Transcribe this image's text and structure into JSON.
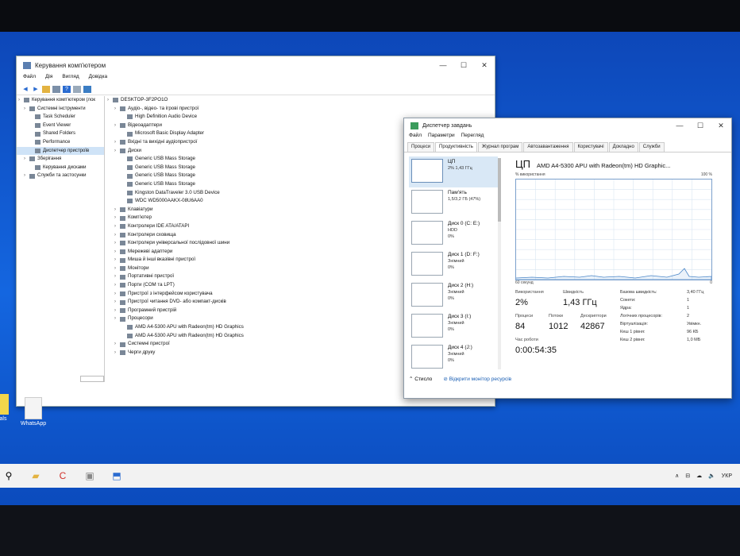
{
  "computer_management": {
    "title": "Керування комп'ютером",
    "menu": [
      "Файл",
      "Дія",
      "Вигляд",
      "Довідка"
    ],
    "left_tree": [
      {
        "label": "Керування комп'ютером (лок",
        "level": 0
      },
      {
        "label": "Системні інструменти",
        "level": 1
      },
      {
        "label": "Task Scheduler",
        "level": 2
      },
      {
        "label": "Event Viewer",
        "level": 2
      },
      {
        "label": "Shared Folders",
        "level": 2
      },
      {
        "label": "Performance",
        "level": 2
      },
      {
        "label": "Диспетчер пристроїв",
        "level": 2
      },
      {
        "label": "Зберігання",
        "level": 1
      },
      {
        "label": "Керування дисками",
        "level": 2
      },
      {
        "label": "Служби та застосунки",
        "level": 1
      }
    ],
    "device_tree": [
      {
        "label": "DESKTOP-3F2PO1O",
        "level": 0
      },
      {
        "label": "Аудіо-, відео- та ігрові пристрої",
        "level": 1
      },
      {
        "label": "High Definition Audio Device",
        "level": 2
      },
      {
        "label": "Відеоадаптери",
        "level": 1
      },
      {
        "label": "Microsoft Basic Display Adapter",
        "level": 2
      },
      {
        "label": "Вхідні та вихідні аудіопристрої",
        "level": 1
      },
      {
        "label": "Диски",
        "level": 1
      },
      {
        "label": "Generic USB Mass Storage",
        "level": 2
      },
      {
        "label": "Generic USB Mass Storage",
        "level": 2
      },
      {
        "label": "Generic USB Mass Storage",
        "level": 2
      },
      {
        "label": "Generic USB Mass Storage",
        "level": 2
      },
      {
        "label": "Kingston DataTraveler 3.0 USB Device",
        "level": 2
      },
      {
        "label": "WDC WD5000AAKX-08U6AA0",
        "level": 2
      },
      {
        "label": "Клавіатури",
        "level": 1
      },
      {
        "label": "Комп'ютер",
        "level": 1
      },
      {
        "label": "Контролери IDE ATA/ATAPI",
        "level": 1
      },
      {
        "label": "Контролери сховища",
        "level": 1
      },
      {
        "label": "Контролери універсальної послідовної шини",
        "level": 1
      },
      {
        "label": "Мережеві адаптери",
        "level": 1
      },
      {
        "label": "Миша й інші вказівні пристрої",
        "level": 1
      },
      {
        "label": "Монітори",
        "level": 1
      },
      {
        "label": "Портативні пристрої",
        "level": 1
      },
      {
        "label": "Порти (COM та LPT)",
        "level": 1
      },
      {
        "label": "Пристрої з інтерфейсом користувача",
        "level": 1
      },
      {
        "label": "Пристрої читання DVD- або компакт-дисків",
        "level": 1
      },
      {
        "label": "Програмний пристрій",
        "level": 1
      },
      {
        "label": "Процесори",
        "level": 1
      },
      {
        "label": "AMD A4-5300 APU with Radeon(tm) HD Graphics",
        "level": 2
      },
      {
        "label": "AMD A4-5300 APU with Radeon(tm) HD Graphics",
        "level": 2
      },
      {
        "label": "Системні пристрої",
        "level": 1
      },
      {
        "label": "Черги друку",
        "level": 1
      }
    ]
  },
  "task_manager": {
    "title": "Диспетчер завдань",
    "menu": [
      "Файл",
      "Параметри",
      "Перегляд"
    ],
    "tabs": [
      "Процеси",
      "Продуктивність",
      "Журнал програм",
      "Автозавантаження",
      "Користувачі",
      "Докладно",
      "Служби"
    ],
    "resources": [
      {
        "name": "ЦП",
        "line1": "2% 1,43 ГГц",
        "line2": ""
      },
      {
        "name": "Пам'ять",
        "line1": "1,5/3,2 ГБ (47%)",
        "line2": ""
      },
      {
        "name": "Диск 0 (C: E:)",
        "line1": "HDD",
        "line2": "0%"
      },
      {
        "name": "Диск 1 (D: F:)",
        "line1": "Знімний",
        "line2": "0%"
      },
      {
        "name": "Диск 2 (H:)",
        "line1": "Знімний",
        "line2": "0%"
      },
      {
        "name": "Диск 3 (I:)",
        "line1": "Знімний",
        "line2": "0%"
      },
      {
        "name": "Диск 4 (J:)",
        "line1": "Знімний",
        "line2": "0%"
      }
    ],
    "cpu": {
      "heading": "ЦП",
      "model": "AMD A4-5300 APU with Radeon(tm) HD Graphic...",
      "graph_label": "% використання",
      "graph_max": "100 %",
      "graph_time": "60 секунд",
      "graph_min": "0",
      "utilization_label": "Використання",
      "utilization": "2%",
      "speed_label": "Швидкість",
      "speed": "1,43 ГГц",
      "processes_label": "Процеси",
      "processes": "84",
      "threads_label": "Потоки",
      "threads": "1012",
      "handles_label": "Дескриптори",
      "handles": "42867",
      "uptime_label": "Час роботи",
      "uptime": "0:00:54:35",
      "details": [
        {
          "k": "Базова швидкість:",
          "v": "3,40 ГГц"
        },
        {
          "k": "Сокети:",
          "v": "1"
        },
        {
          "k": "Ядра:",
          "v": "1"
        },
        {
          "k": "Логічних процесорів:",
          "v": "2"
        },
        {
          "k": "Віртуалізація:",
          "v": "Увімкн."
        },
        {
          "k": "Кеш 1 рівня:",
          "v": "96 КБ"
        },
        {
          "k": "Кеш 2 рівня:",
          "v": "1,0 МБ"
        }
      ]
    },
    "footer": {
      "fewer": "Стисло",
      "monitor": "Відкрити монітор ресурсів"
    }
  },
  "desktop": {
    "icon_label": "WhatsApp",
    "left_icon_label": "als"
  },
  "tray": {
    "lang": "УКР"
  },
  "colors": {
    "accent": "#1a5fb4",
    "desktop": "#1466e0",
    "selection": "#cfe3f7"
  }
}
